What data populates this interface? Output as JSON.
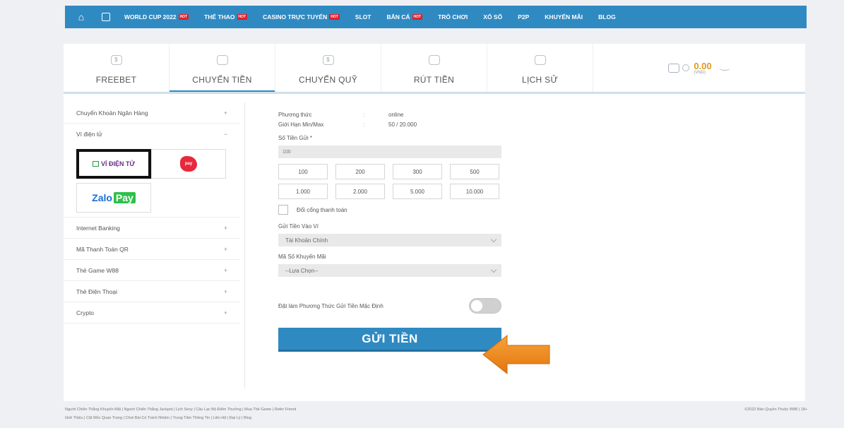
{
  "nav": {
    "items": [
      {
        "label": "WORLD CUP 2022",
        "hot": true
      },
      {
        "label": "THỂ THAO",
        "hot": true
      },
      {
        "label": "CASINO TRỰC TUYẾN",
        "hot": true
      },
      {
        "label": "SLOT",
        "hot": false
      },
      {
        "label": "BẮN CÁ",
        "hot": true
      },
      {
        "label": "TRÒ CHƠI",
        "hot": false
      },
      {
        "label": "XỔ SỐ",
        "hot": false
      },
      {
        "label": "P2P",
        "hot": false
      },
      {
        "label": "KHUYẾN MÃI",
        "hot": false
      },
      {
        "label": "BLOG",
        "hot": false
      }
    ],
    "hot_badge": "HOT"
  },
  "tabs": [
    {
      "label": "FREEBET",
      "icon": "$"
    },
    {
      "label": "CHUYỂN TIỀN",
      "icon": "",
      "active": true
    },
    {
      "label": "CHUYỂN QUỸ",
      "icon": "$"
    },
    {
      "label": "RÚT TIỀN",
      "icon": ""
    },
    {
      "label": "LỊCH SỬ",
      "icon": ""
    }
  ],
  "wallet": {
    "amount": "0.00",
    "currency": "(VND)"
  },
  "sidebar": {
    "items": [
      {
        "label": "Chuyển Khoản Ngân Hàng",
        "toggle": "+"
      },
      {
        "label": "Ví điện tử",
        "toggle": "−"
      },
      {
        "label": "Internet Banking",
        "toggle": "+"
      },
      {
        "label": "Mã Thanh Toán QR",
        "toggle": "+"
      },
      {
        "label": "Thẻ Game W88",
        "toggle": "+"
      },
      {
        "label": "Thẻ Điện Thoại",
        "toggle": "+"
      },
      {
        "label": "Crypto",
        "toggle": "+"
      }
    ],
    "ewallets": {
      "vidientu": "VÍ ĐIỆN TỬ",
      "viettelpay": "pay",
      "zalo": "Zalo",
      "zalo_pay": "Pay"
    }
  },
  "form": {
    "method_label": "Phương thức",
    "method_value": "online",
    "limit_label": "Giới Hạn Min/Max",
    "limit_value": "50 / 20.000",
    "amount_label": "Số Tiền Gửi *",
    "amount_value": "100",
    "quick_amounts": [
      "100",
      "200",
      "300",
      "500",
      "1.000",
      "2.000",
      "5.000",
      "10.000"
    ],
    "switch_gateway_label": "Đổi cổng thanh toán",
    "wallet_label": "Gửi Tiền Vào Ví",
    "wallet_value": "Tài Khoản Chính",
    "promo_label": "Mã Số Khuyến Mãi",
    "promo_value": "--Lựa Chọn--",
    "default_label": "Đặt làm Phương Thức Gửi Tiền Mặc Định",
    "submit_label": "GỬI TIỀN"
  },
  "footer": {
    "line1": "Người Chiến Thắng Khuyến Mãi | Người Chiến Thắng Jackpot | Lịch Sexy | Câu Lạc Bộ Điểm Thưởng | Mua Thẻ Game | Refer Friend",
    "line2": "Giới Thiệu | Cột Mốc Quan Trọng | Chơi Bài Có Trách Nhiệm | Trung Tâm Thông Tin | Liên Hệ | Đại Lý | Blog",
    "copyright": "©2022 Bản Quyền Thuộc W88 | 18+"
  },
  "colors": {
    "brand": "#2f8ac2",
    "accent_arrow": "#f28c1a",
    "balance": "#e39a1a"
  }
}
